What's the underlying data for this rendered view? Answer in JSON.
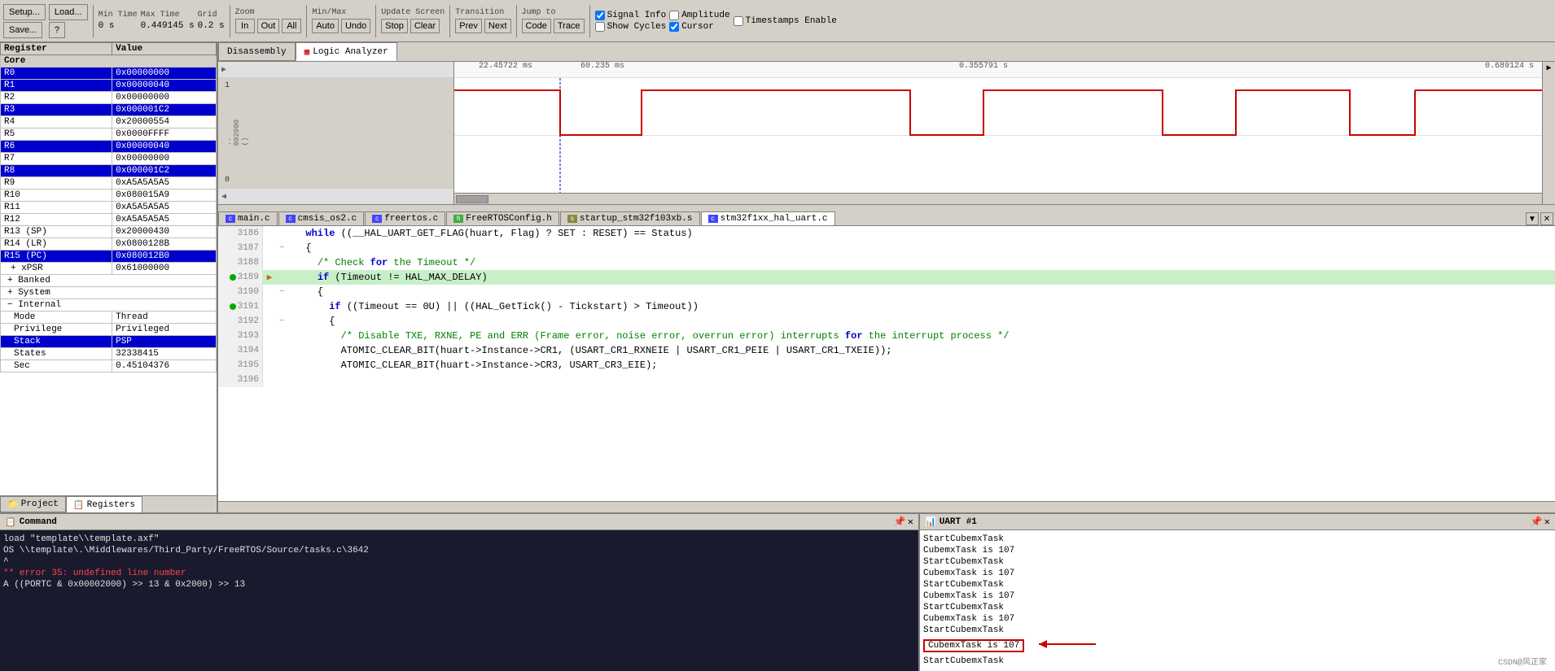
{
  "toolbar": {
    "setup_label": "Setup...",
    "load_label": "Load...",
    "save_label": "Save...",
    "help_label": "?",
    "min_time_label": "Min Time",
    "min_time_value": "0 s",
    "max_time_label": "Max Time",
    "max_time_value": "0.449145 s",
    "grid_label": "Grid",
    "grid_value": "0.2 s",
    "zoom_label": "Zoom",
    "zoom_in": "In",
    "zoom_out": "Out",
    "zoom_all": "All",
    "min_max_label": "Min/Max",
    "auto_btn": "Auto",
    "undo_btn": "Undo",
    "update_label": "Update Screen",
    "stop_btn": "Stop",
    "clear_btn": "Clear",
    "transition_label": "Transition",
    "prev_btn": "Prev",
    "next_btn": "Next",
    "jump_label": "Jump to",
    "code_btn": "Code",
    "trace_btn": "Trace",
    "signal_info_cb": "Signal Info",
    "amplitude_cb": "Amplitude",
    "timestamps_cb": "Timestamps Enable",
    "show_cycles_cb": "Show Cycles",
    "cursor_cb": "Cursor"
  },
  "registers": {
    "headers": [
      "Register",
      "Value"
    ],
    "core_label": "Core",
    "rows": [
      {
        "name": "R0",
        "value": "0x00000000",
        "highlight": true
      },
      {
        "name": "R1",
        "value": "0x00000040",
        "highlight": true
      },
      {
        "name": "R2",
        "value": "0x00000000",
        "highlight": false
      },
      {
        "name": "R3",
        "value": "0x000001C2",
        "highlight": true
      },
      {
        "name": "R4",
        "value": "0x20000554",
        "highlight": false
      },
      {
        "name": "R5",
        "value": "0x0000FFFF",
        "highlight": false
      },
      {
        "name": "R6",
        "value": "0x00000040",
        "highlight": true
      },
      {
        "name": "R7",
        "value": "0x00000000",
        "highlight": false
      },
      {
        "name": "R8",
        "value": "0x000001C2",
        "highlight": true
      },
      {
        "name": "R9",
        "value": "0xA5A5A5A5",
        "highlight": false
      },
      {
        "name": "R10",
        "value": "0x080015A9",
        "highlight": false
      },
      {
        "name": "R11",
        "value": "0xA5A5A5A5",
        "highlight": false
      },
      {
        "name": "R12",
        "value": "0xA5A5A5A5",
        "highlight": false
      },
      {
        "name": "R13 (SP)",
        "value": "0x20000430",
        "highlight": false
      },
      {
        "name": "R14 (LR)",
        "value": "0x0800128B",
        "highlight": false
      },
      {
        "name": "R15 (PC)",
        "value": "0x080012B0",
        "highlight": true
      }
    ],
    "xpsr": {
      "name": "xPSR",
      "value": "0x61000000"
    },
    "banked_label": "Banked",
    "system_label": "System",
    "internal_label": "Internal",
    "internal_rows": [
      {
        "name": "Mode",
        "value": "Thread"
      },
      {
        "name": "Privilege",
        "value": "Privileged"
      },
      {
        "name": "Stack",
        "value": "PSP",
        "highlight": true
      },
      {
        "name": "States",
        "value": "32338415"
      },
      {
        "name": "Sec",
        "value": "0.45104376"
      }
    ]
  },
  "bottom_tabs": {
    "project": "Project",
    "registers": "Registers"
  },
  "waveform": {
    "tabs": [
      {
        "label": "Disassembly",
        "active": false
      },
      {
        "label": "Logic Analyzer",
        "active": true
      }
    ],
    "time_markers": [
      "22.45722 ms",
      "60.235 ms",
      "0.355791 s",
      "0.689124 s"
    ],
    "y_labels": [
      "1",
      "0"
    ],
    "left_label": "..002000()"
  },
  "code_tabs": [
    {
      "label": "main.c",
      "type": "c",
      "active": false
    },
    {
      "label": "cmsis_os2.c",
      "type": "c",
      "active": false
    },
    {
      "label": "freertos.c",
      "type": "c",
      "active": false
    },
    {
      "label": "FreeRTOSConfig.h",
      "type": "h",
      "active": false
    },
    {
      "label": "startup_stm32f103xb.s",
      "type": "s",
      "active": false
    },
    {
      "label": "stm32f1xx_hal_uart.c",
      "type": "c",
      "active": true
    }
  ],
  "code_lines": [
    {
      "num": 3186,
      "indicator": false,
      "current": false,
      "content": "  while ((__HAL_UART_GET_FLAG(huart, Flag) ? SET : RESET) == Status)",
      "fold": false
    },
    {
      "num": 3187,
      "indicator": false,
      "current": false,
      "content": "  {",
      "fold": true
    },
    {
      "num": 3188,
      "indicator": false,
      "current": false,
      "content": "    /* Check for the Timeout */",
      "fold": false
    },
    {
      "num": 3189,
      "indicator": true,
      "current": true,
      "content": "    if (Timeout != HAL_MAX_DELAY)",
      "fold": false,
      "arrow": true
    },
    {
      "num": 3190,
      "indicator": false,
      "current": false,
      "content": "    {",
      "fold": true
    },
    {
      "num": 3191,
      "indicator": true,
      "current": false,
      "content": "      if ((Timeout == 0U) || ((HAL_GetTick() - Tickstart) > Timeout))",
      "fold": false
    },
    {
      "num": 3192,
      "indicator": false,
      "current": false,
      "content": "      {",
      "fold": true
    },
    {
      "num": 3193,
      "indicator": false,
      "current": false,
      "content": "        /* Disable TXE, RXNE, PE and ERR (Frame error, noise error, overrun error) interrupts for the interrupt process */",
      "fold": false
    },
    {
      "num": 3194,
      "indicator": false,
      "current": false,
      "content": "        ATOMIC_CLEAR_BIT(huart->Instance->CR1, (USART_CR1_RXNEIE | USART_CR1_PEIE | USART_CR1_TXEIE));",
      "fold": false
    },
    {
      "num": 3195,
      "indicator": false,
      "current": false,
      "content": "        ATOMIC_CLEAR_BIT(huart->Instance->CR3, USART_CR3_EIE);",
      "fold": false
    },
    {
      "num": 3196,
      "indicator": false,
      "current": false,
      "content": "",
      "fold": false
    }
  ],
  "command_panel": {
    "title": "Command",
    "lines": [
      {
        "text": "load \"template\\\\template.axf\"",
        "type": "normal"
      },
      {
        "text": "OS \\\\template\\.\\Middlewares/Third_Party/FreeRTOS/Source/tasks.c\\3642",
        "type": "normal"
      },
      {
        "text": "^",
        "type": "normal"
      },
      {
        "text": "** error 35: undefined line number",
        "type": "error"
      },
      {
        "text": "A ((PORTC & 0x00002000) >> 13 & 0x2000) >> 13",
        "type": "normal"
      }
    ]
  },
  "uart_panel": {
    "title": "UART #1",
    "lines": [
      {
        "text": "StartCubemxTask",
        "highlight": false
      },
      {
        "text": "CubemxTask is 107",
        "highlight": false
      },
      {
        "text": "StartCubemxTask",
        "highlight": false
      },
      {
        "text": "CubemxTask is 107",
        "highlight": false
      },
      {
        "text": "StartCubemxTask",
        "highlight": false
      },
      {
        "text": "CubemxTask is 107",
        "highlight": false
      },
      {
        "text": "StartCubemxTask",
        "highlight": false
      },
      {
        "text": "CubemxTask is 107",
        "highlight": false
      },
      {
        "text": "StartCubemxTask",
        "highlight": true
      },
      {
        "text": "CubemxTask is 107",
        "highlight": true,
        "box": true
      },
      {
        "text": "StartCubemxTask",
        "highlight": false
      }
    ]
  },
  "watermark": "CSDN@风正家"
}
